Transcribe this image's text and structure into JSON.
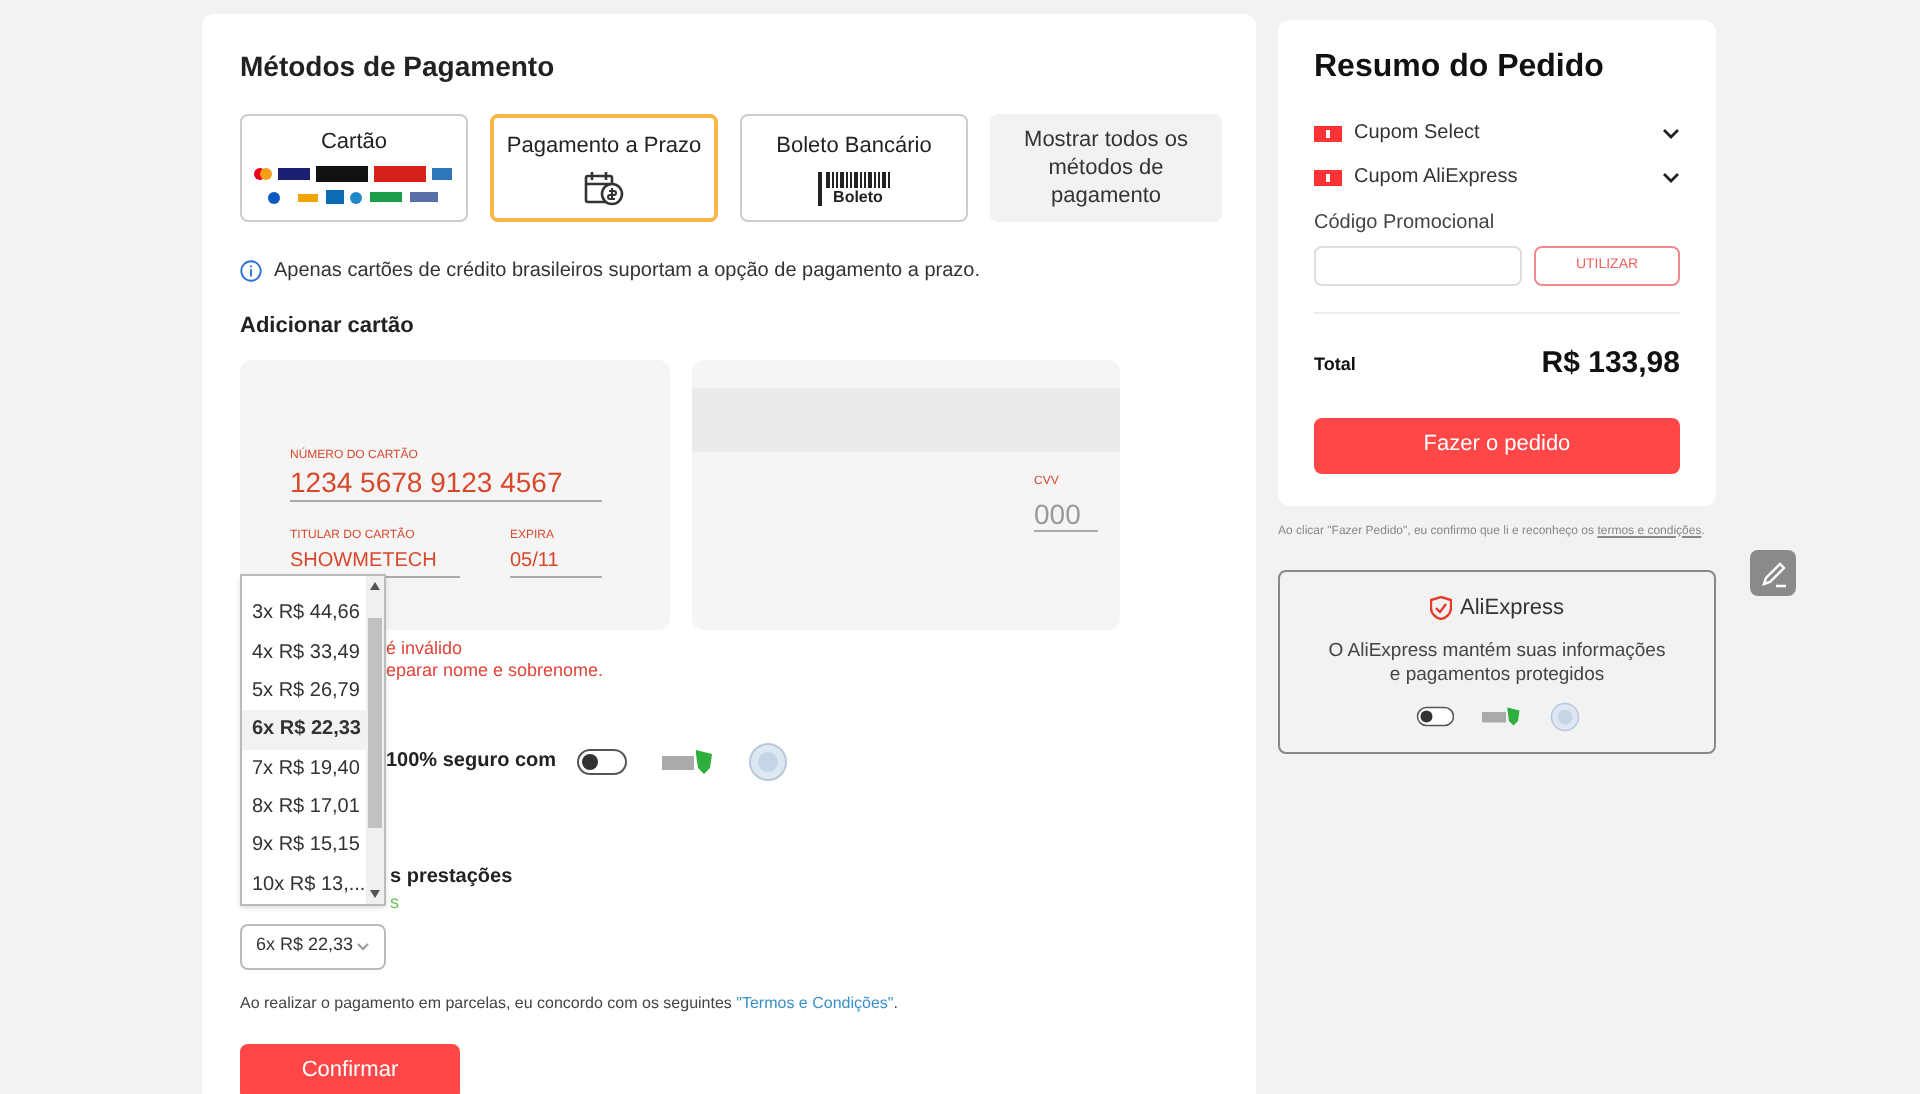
{
  "payment": {
    "title": "Métodos de Pagamento",
    "methods": [
      {
        "kind": "cards",
        "label": "Cartão",
        "selected": false
      },
      {
        "kind": "installment",
        "label": "Pagamento a Prazo",
        "selected": true
      },
      {
        "kind": "boleto",
        "label": "Boleto Bancário",
        "icon_text": "Boleto",
        "selected": false
      },
      {
        "kind": "more",
        "label": "Mostrar todos os métodos de pagamento"
      }
    ],
    "info": "Apenas cartões de crédito brasileiros suportam a opção de pagamento a prazo.",
    "add_card_title": "Adicionar cartão",
    "card": {
      "number_label": "NÚMERO DO CARTÃO",
      "number": "1234 5678 9123 4567",
      "holder_label": "TITULAR DO CARTÃO",
      "holder": "SHOWMETECH",
      "expiry_label": "EXPIRA",
      "expiry": "05/11",
      "cvv_label": "CVV",
      "cvv_placeholder": "000"
    },
    "errors": [
      "é inválido",
      "eparar nome e sobrenome."
    ],
    "secure_text": "100% seguro com",
    "installments_title": "s prestações",
    "installments_note": "s",
    "installment_options": [
      {
        "label": "3x R$ 44,66",
        "selected": false
      },
      {
        "label": "4x R$ 33,49",
        "selected": false
      },
      {
        "label": "5x R$ 26,79",
        "selected": false
      },
      {
        "label": "6x R$ 22,33",
        "selected": true
      },
      {
        "label": "7x R$ 19,40",
        "selected": false
      },
      {
        "label": "8x R$ 17,01",
        "selected": false
      },
      {
        "label": "9x R$ 15,15",
        "selected": false
      },
      {
        "label": "10x R$ 13,...",
        "selected": false
      }
    ],
    "installment_value": "6x R$ 22,33",
    "terms": {
      "text": "Ao realizar o pagamento em parcelas, eu concordo com os seguintes ",
      "link": "\"Termos e Condições\"",
      "end": "."
    },
    "confirm": "Confirmar"
  },
  "summary": {
    "title": "Resumo do Pedido",
    "coupons": [
      {
        "label": "Cupom Select",
        "expanded": false
      },
      {
        "label": "Cupom AliExpress",
        "expanded": false
      }
    ],
    "promo_label": "Código Promocional",
    "apply": "UTILIZAR",
    "total_label": "Total",
    "total": "R$ 133,98",
    "order_button": "Fazer o pedido"
  },
  "disclaimer": {
    "text": "Ao clicar \"Fazer Pedido\", eu confirmo que li e reconheço os ",
    "link": "termos e condições",
    "end": "."
  },
  "trust": {
    "brand": "AliExpress",
    "text": "O AliExpress mantém suas informações e pagamentos protegidos"
  }
}
